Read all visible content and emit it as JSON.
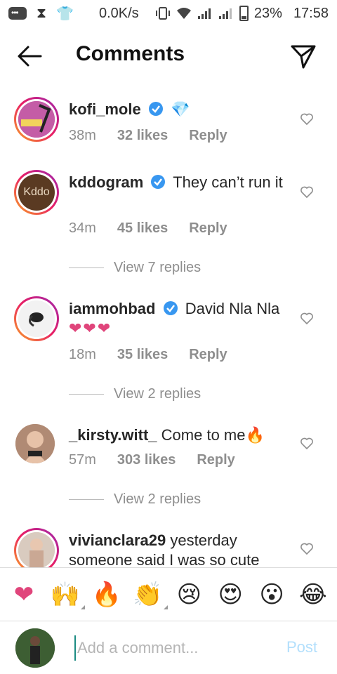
{
  "status_bar": {
    "speed": "0.0K/s",
    "battery": "23%",
    "time": "17:58"
  },
  "header": {
    "title": "Comments"
  },
  "comments": [
    {
      "username": "kofi_mole",
      "text": "💎",
      "time": "38m",
      "likes": "32 likes",
      "reply": "Reply"
    },
    {
      "username": "kddogram",
      "text": "They can’t run it",
      "time": "34m",
      "likes": "45 likes",
      "reply": "Reply",
      "view_replies": "View 7 replies",
      "avatar_text": "Kddo"
    },
    {
      "username": "iammohbad",
      "text": "David Nla Nla",
      "hearts": "❤❤❤",
      "time": "18m",
      "likes": "35 likes",
      "reply": "Reply",
      "view_replies": "View 2 replies"
    },
    {
      "username": "_kirsty.witt_",
      "text": "Come to me🔥",
      "time": "57m",
      "likes": "303 likes",
      "reply": "Reply",
      "view_replies": "View 2 replies"
    },
    {
      "username": "vivianclara29",
      "text": "yesterday someone said I was so cute"
    }
  ],
  "emoji_bar": [
    "❤",
    "🙌",
    "🔥",
    "👏",
    "😢",
    "😍",
    "😮",
    "😂"
  ],
  "composer": {
    "placeholder": "Add a comment...",
    "post_label": "Post"
  },
  "colors": {
    "accent_blue": "#0095f6",
    "post_disabled": "#b2dffc",
    "heart_pink": "#e0457b"
  }
}
